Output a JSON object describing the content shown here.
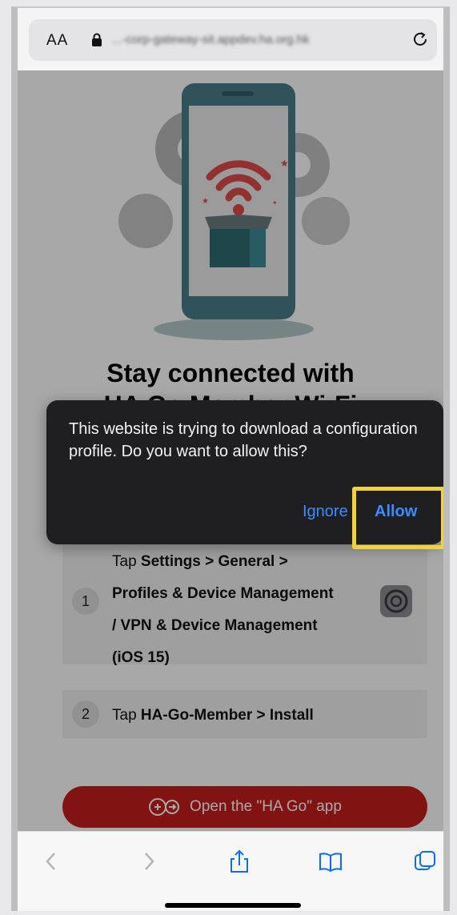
{
  "browser": {
    "text_size_label": "AA",
    "url": "...-corp-gateway-sit.appdev.ha.org.hk"
  },
  "page": {
    "title_line1": "Stay connected with",
    "title_line2": "HA Go Member Wi-Fi",
    "step1_number": "1",
    "step1_line1_prefix": "Tap ",
    "step1_line1_bold": "Settings > General >",
    "step1_line2": "Profiles & Device Management",
    "step1_line3_bold": "/ VPN",
    "step1_line3_rest": " & Device Management",
    "step1_line4": "(iOS 15)",
    "step2_number": "2",
    "step2_prefix": "Tap ",
    "step2_bold": "HA-Go-Member > Install",
    "open_app_label": "Open the \"HA Go\" app"
  },
  "dialog": {
    "message": "This website is trying to download a configuration profile. Do you want to allow this?",
    "ignore_label": "Ignore",
    "allow_label": "Allow"
  },
  "icons": {
    "lock": "lock-icon",
    "reload": "reload-icon",
    "back": "chevron-left-icon",
    "forward": "chevron-right-icon",
    "share": "share-icon",
    "bookmarks": "book-icon",
    "tabs": "tabs-icon",
    "settings": "settings-gear-icon"
  },
  "colors": {
    "accent_blue": "#3b8cff",
    "button_red": "#c41e1e",
    "highlight_yellow": "#f2d13b",
    "dialog_bg": "#1f1f21"
  }
}
